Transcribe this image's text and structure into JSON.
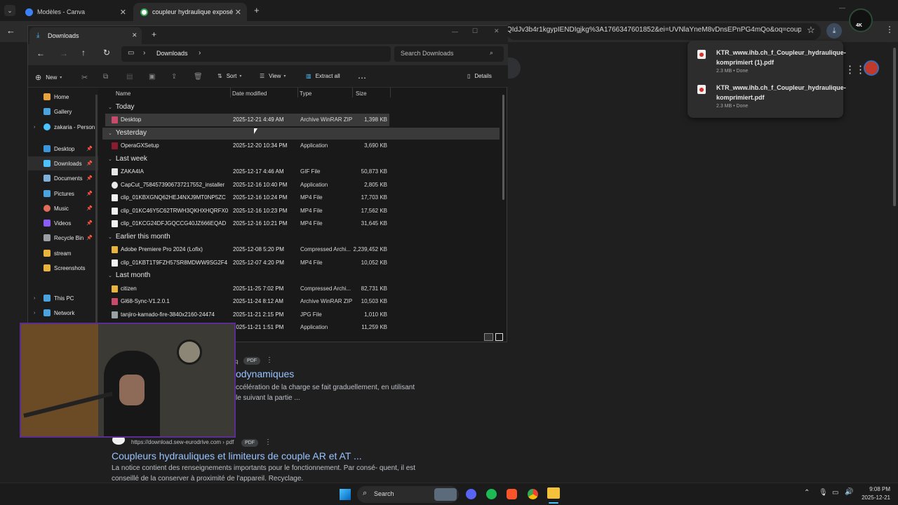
{
  "browser": {
    "tabs": [
      {
        "label": "Modèles - Canva",
        "active": false
      },
      {
        "label": "coupleur hydraulique exposé p",
        "active": true
      }
    ],
    "url_fragment": "QIdJv3b4r1kgypIENDIgjkg%3A1766347601852&ei=UVNlaYneM8vDnsEPnPG4mQo&oq=couple...",
    "downloads": [
      {
        "name": "KTR_www.ihb.ch_f_Coupleur_hydraulique-komprimiert (1).pdf",
        "status": "2.3 MB • Done"
      },
      {
        "name": "KTR_www.ihb.ch_f_Coupleur_hydraulique-komprimiert.pdf",
        "status": "2.3 MB • Done"
      }
    ]
  },
  "serp": {
    "result1": {
      "badge": "PDF",
      "title": "odynamiques",
      "snippet": "ccélération de la charge se fait graduellement, en utilisant le suivant la partie ..."
    },
    "result2": {
      "source": "https://download.sew-eurodrive.com › pdf",
      "badge": "PDF",
      "title": "Coupleurs hydrauliques et limiteurs de couple AR et AT ...",
      "snippet": "La notice contient des renseignements importants pour le fonctionnement. Par consé- quent, il est conseillé de la conserver à proximité de l'appareil. Recyclage."
    }
  },
  "explorer": {
    "tab_title": "Downloads",
    "breadcrumb": "Downloads",
    "search_placeholder": "Search Downloads",
    "commands": {
      "new": "New",
      "sort": "Sort",
      "view": "View",
      "extract": "Extract all",
      "details": "Details"
    },
    "columns": {
      "name": "Name",
      "date": "Date modified",
      "type": "Type",
      "size": "Size"
    },
    "sidebar": [
      "Home",
      "Gallery",
      "zakaria - Person",
      "Desktop",
      "Downloads",
      "Documents",
      "Pictures",
      "Music",
      "Videos",
      "Recycle Bin",
      "stream",
      "Screenshots",
      "This PC",
      "Network"
    ],
    "groups": [
      "Today",
      "Yesterday",
      "Last week",
      "Earlier this month",
      "Last month"
    ],
    "files": [
      {
        "name": "Desktop",
        "date": "2025-12-21 4:49 AM",
        "type": "Archive WinRAR ZIP",
        "size": "1,398 KB"
      },
      {
        "name": "OperaGXSetup",
        "date": "2025-12-20 10:34 PM",
        "type": "Application",
        "size": "3,690 KB"
      },
      {
        "name": "ZAKA4IA",
        "date": "2025-12-17 4:46 AM",
        "type": "GIF File",
        "size": "50,873 KB"
      },
      {
        "name": "CapCut_7584573906737217552_installer",
        "date": "2025-12-16 10:40 PM",
        "type": "Application",
        "size": "2,805 KB"
      },
      {
        "name": "clip_01KBXGNQ62HEJ4NXJ9MT0NP5ZC",
        "date": "2025-12-16 10:24 PM",
        "type": "MP4 File",
        "size": "17,703 KB"
      },
      {
        "name": "clip_01KC46Y5C62TRWH3QKHXHQRFX0",
        "date": "2025-12-16 10:23 PM",
        "type": "MP4 File",
        "size": "17,562 KB"
      },
      {
        "name": "clip_01KCG24DFJGQCCG40JZ666EQAD",
        "date": "2025-12-16 10:21 PM",
        "type": "MP4 File",
        "size": "31,645 KB"
      },
      {
        "name": "Adobe Premiere Pro 2024 (Lofix)",
        "date": "2025-12-08 5:20 PM",
        "type": "Compressed Archi...",
        "size": "2,239,452 KB"
      },
      {
        "name": "clip_01KBT1T9FZH57SR8MDWW9SG2F4",
        "date": "2025-12-07 4:20 PM",
        "type": "MP4 File",
        "size": "10,052 KB"
      },
      {
        "name": "citizen",
        "date": "2025-11-25 7:02 PM",
        "type": "Compressed Archi...",
        "size": "82,731 KB"
      },
      {
        "name": "Gl68-Sync-V1.2.0.1",
        "date": "2025-11-24 8:12 AM",
        "type": "Archive WinRAR ZIP",
        "size": "10,503 KB"
      },
      {
        "name": "tanjiro-kamado-fire-3840x2160-24474",
        "date": "2025-11-21 2:15 PM",
        "type": "JPG File",
        "size": "1,010 KB"
      },
      {
        "name": "",
        "date": "2025-11-21 1:51 PM",
        "type": "Application",
        "size": "11,259 KB"
      }
    ]
  },
  "taskbar": {
    "search": "Search",
    "time": "9:08 PM",
    "date": "2025-12-21"
  },
  "colors": {
    "accent": "#4cc2ff",
    "link": "#99c3ff",
    "webcam_border": "#5b2d90"
  }
}
